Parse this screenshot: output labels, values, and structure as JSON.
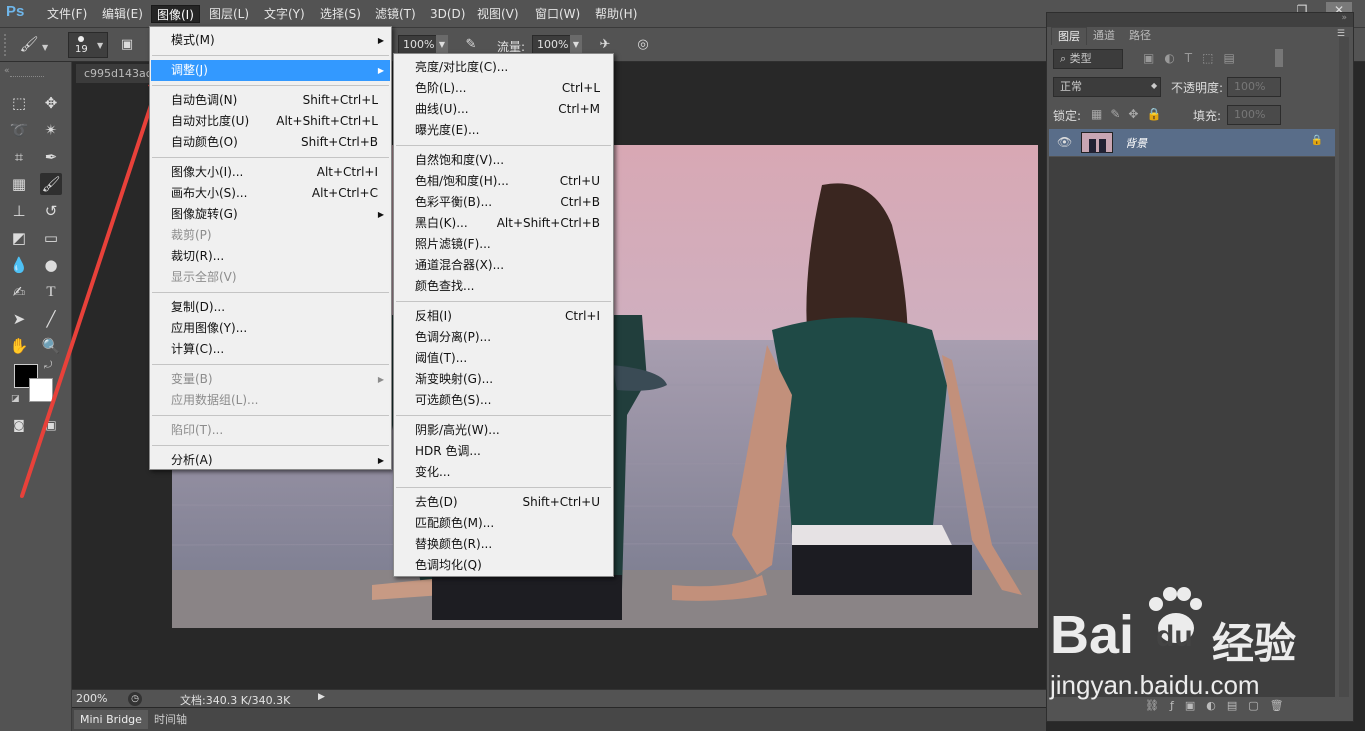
{
  "menubar": {
    "logo": "Ps",
    "items": [
      "文件(F)",
      "编辑(E)",
      "图像(I)",
      "图层(L)",
      "文字(Y)",
      "选择(S)",
      "滤镜(T)",
      "3D(D)",
      "视图(V)",
      "窗口(W)",
      "帮助(H)"
    ],
    "active_index": 2
  },
  "options": {
    "brush_size": "19",
    "opacity_value": "100%",
    "flow_label": "流量:",
    "flow_value": "100%"
  },
  "document": {
    "tab_title": "c995d143ac",
    "zoom": "200%",
    "doc_info": "文档:340.3 K/340.3K"
  },
  "bottom_tabs": [
    "Mini Bridge",
    "时间轴"
  ],
  "image_menu": [
    {
      "label": "模式(M)",
      "shortcut": "",
      "submenu": true,
      "disabled": false
    },
    {
      "sep": true
    },
    {
      "label": "调整(J)",
      "shortcut": "",
      "submenu": true,
      "disabled": false,
      "highlight": true
    },
    {
      "sep": true
    },
    {
      "label": "自动色调(N)",
      "shortcut": "Shift+Ctrl+L",
      "disabled": false
    },
    {
      "label": "自动对比度(U)",
      "shortcut": "Alt+Shift+Ctrl+L",
      "disabled": false
    },
    {
      "label": "自动颜色(O)",
      "shortcut": "Shift+Ctrl+B",
      "disabled": false
    },
    {
      "sep": true
    },
    {
      "label": "图像大小(I)...",
      "shortcut": "Alt+Ctrl+I",
      "disabled": false
    },
    {
      "label": "画布大小(S)...",
      "shortcut": "Alt+Ctrl+C",
      "disabled": false
    },
    {
      "label": "图像旋转(G)",
      "shortcut": "",
      "submenu": true,
      "disabled": false
    },
    {
      "label": "裁剪(P)",
      "shortcut": "",
      "disabled": true
    },
    {
      "label": "裁切(R)...",
      "shortcut": "",
      "disabled": false
    },
    {
      "label": "显示全部(V)",
      "shortcut": "",
      "disabled": true
    },
    {
      "sep": true
    },
    {
      "label": "复制(D)...",
      "shortcut": "",
      "disabled": false
    },
    {
      "label": "应用图像(Y)...",
      "shortcut": "",
      "disabled": false
    },
    {
      "label": "计算(C)...",
      "shortcut": "",
      "disabled": false
    },
    {
      "sep": true
    },
    {
      "label": "变量(B)",
      "shortcut": "",
      "submenu": true,
      "disabled": true
    },
    {
      "label": "应用数据组(L)...",
      "shortcut": "",
      "disabled": true
    },
    {
      "sep": true
    },
    {
      "label": "陷印(T)...",
      "shortcut": "",
      "disabled": true
    },
    {
      "sep": true
    },
    {
      "label": "分析(A)",
      "shortcut": "",
      "submenu": true,
      "disabled": false
    }
  ],
  "adjust_menu": [
    {
      "label": "亮度/对比度(C)...",
      "shortcut": ""
    },
    {
      "label": "色阶(L)...",
      "shortcut": "Ctrl+L"
    },
    {
      "label": "曲线(U)...",
      "shortcut": "Ctrl+M"
    },
    {
      "label": "曝光度(E)...",
      "shortcut": ""
    },
    {
      "sep": true
    },
    {
      "label": "自然饱和度(V)...",
      "shortcut": ""
    },
    {
      "label": "色相/饱和度(H)...",
      "shortcut": "Ctrl+U"
    },
    {
      "label": "色彩平衡(B)...",
      "shortcut": "Ctrl+B"
    },
    {
      "label": "黑白(K)...",
      "shortcut": "Alt+Shift+Ctrl+B"
    },
    {
      "label": "照片滤镜(F)...",
      "shortcut": ""
    },
    {
      "label": "通道混合器(X)...",
      "shortcut": ""
    },
    {
      "label": "颜色查找...",
      "shortcut": ""
    },
    {
      "sep": true
    },
    {
      "label": "反相(I)",
      "shortcut": "Ctrl+I"
    },
    {
      "label": "色调分离(P)...",
      "shortcut": ""
    },
    {
      "label": "阈值(T)...",
      "shortcut": ""
    },
    {
      "label": "渐变映射(G)...",
      "shortcut": ""
    },
    {
      "label": "可选颜色(S)...",
      "shortcut": ""
    },
    {
      "sep": true
    },
    {
      "label": "阴影/高光(W)...",
      "shortcut": ""
    },
    {
      "label": "HDR 色调...",
      "shortcut": ""
    },
    {
      "label": "变化...",
      "shortcut": ""
    },
    {
      "sep": true
    },
    {
      "label": "去色(D)",
      "shortcut": "Shift+Ctrl+U"
    },
    {
      "label": "匹配颜色(M)...",
      "shortcut": ""
    },
    {
      "label": "替换颜色(R)...",
      "shortcut": ""
    },
    {
      "label": "色调均化(Q)",
      "shortcut": ""
    }
  ],
  "layers_panel": {
    "tabs": [
      "图层",
      "通道",
      "路径"
    ],
    "filter_kind": "类型",
    "blend_mode": "正常",
    "opacity_label": "不透明度:",
    "opacity_value": "100%",
    "lock_label": "锁定:",
    "fill_label": "填充:",
    "fill_value": "100%",
    "layer_name": "背景"
  },
  "watermark": {
    "brand": "Bai",
    "brand_suffix": "du",
    "cn": "经验",
    "url": "jingyan.baidu.com"
  },
  "colors": {
    "ui_bg": "#535353",
    "menu_highlight": "#3399ff",
    "annotation_arrow": "#e8413a",
    "layer_selected": "#596d89"
  }
}
